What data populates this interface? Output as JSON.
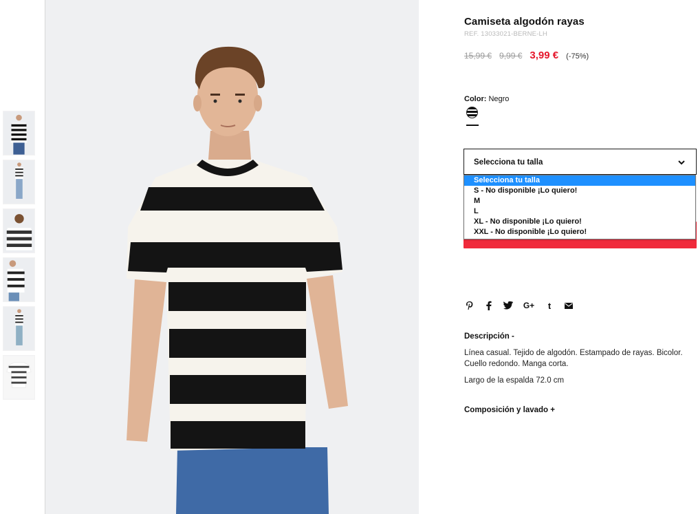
{
  "product": {
    "title": "Camiseta algodón rayas",
    "ref": "REF. 13033021-BERNE-LH",
    "price_original": "15,99 €",
    "price_previous": "9,99 €",
    "price_current": "3,99 €",
    "discount": "(-75%)"
  },
  "color": {
    "label": "Color:",
    "value": "Negro"
  },
  "size": {
    "select_label": "Selecciona tu talla",
    "options": [
      "Selecciona tu talla",
      "S - No disponible ¡Lo quiero!",
      "M",
      "L",
      "XL - No disponible ¡Lo quiero!",
      "XXL - No disponible ¡Lo quiero!"
    ],
    "selected_index": 0
  },
  "share": {
    "icons": [
      "pinterest-icon",
      "facebook-icon",
      "twitter-icon",
      "google-plus-icon",
      "tumblr-icon",
      "email-icon"
    ],
    "glyphs": [
      "𝓅",
      "f",
      "🐦",
      "G+",
      "t",
      "✉"
    ]
  },
  "description": {
    "heading": "Descripción  -",
    "text": "Línea casual. Tejido de algodón. Estampado de rayas. Bicolor. Cuello redondo. Manga corta.",
    "length": "Largo de la espalda 72.0 cm"
  },
  "composition": {
    "heading": "Composición y lavado  +"
  },
  "colors": {
    "accent": "#f02a3b",
    "price_red": "#e5172b",
    "highlight": "#1e90ff"
  }
}
